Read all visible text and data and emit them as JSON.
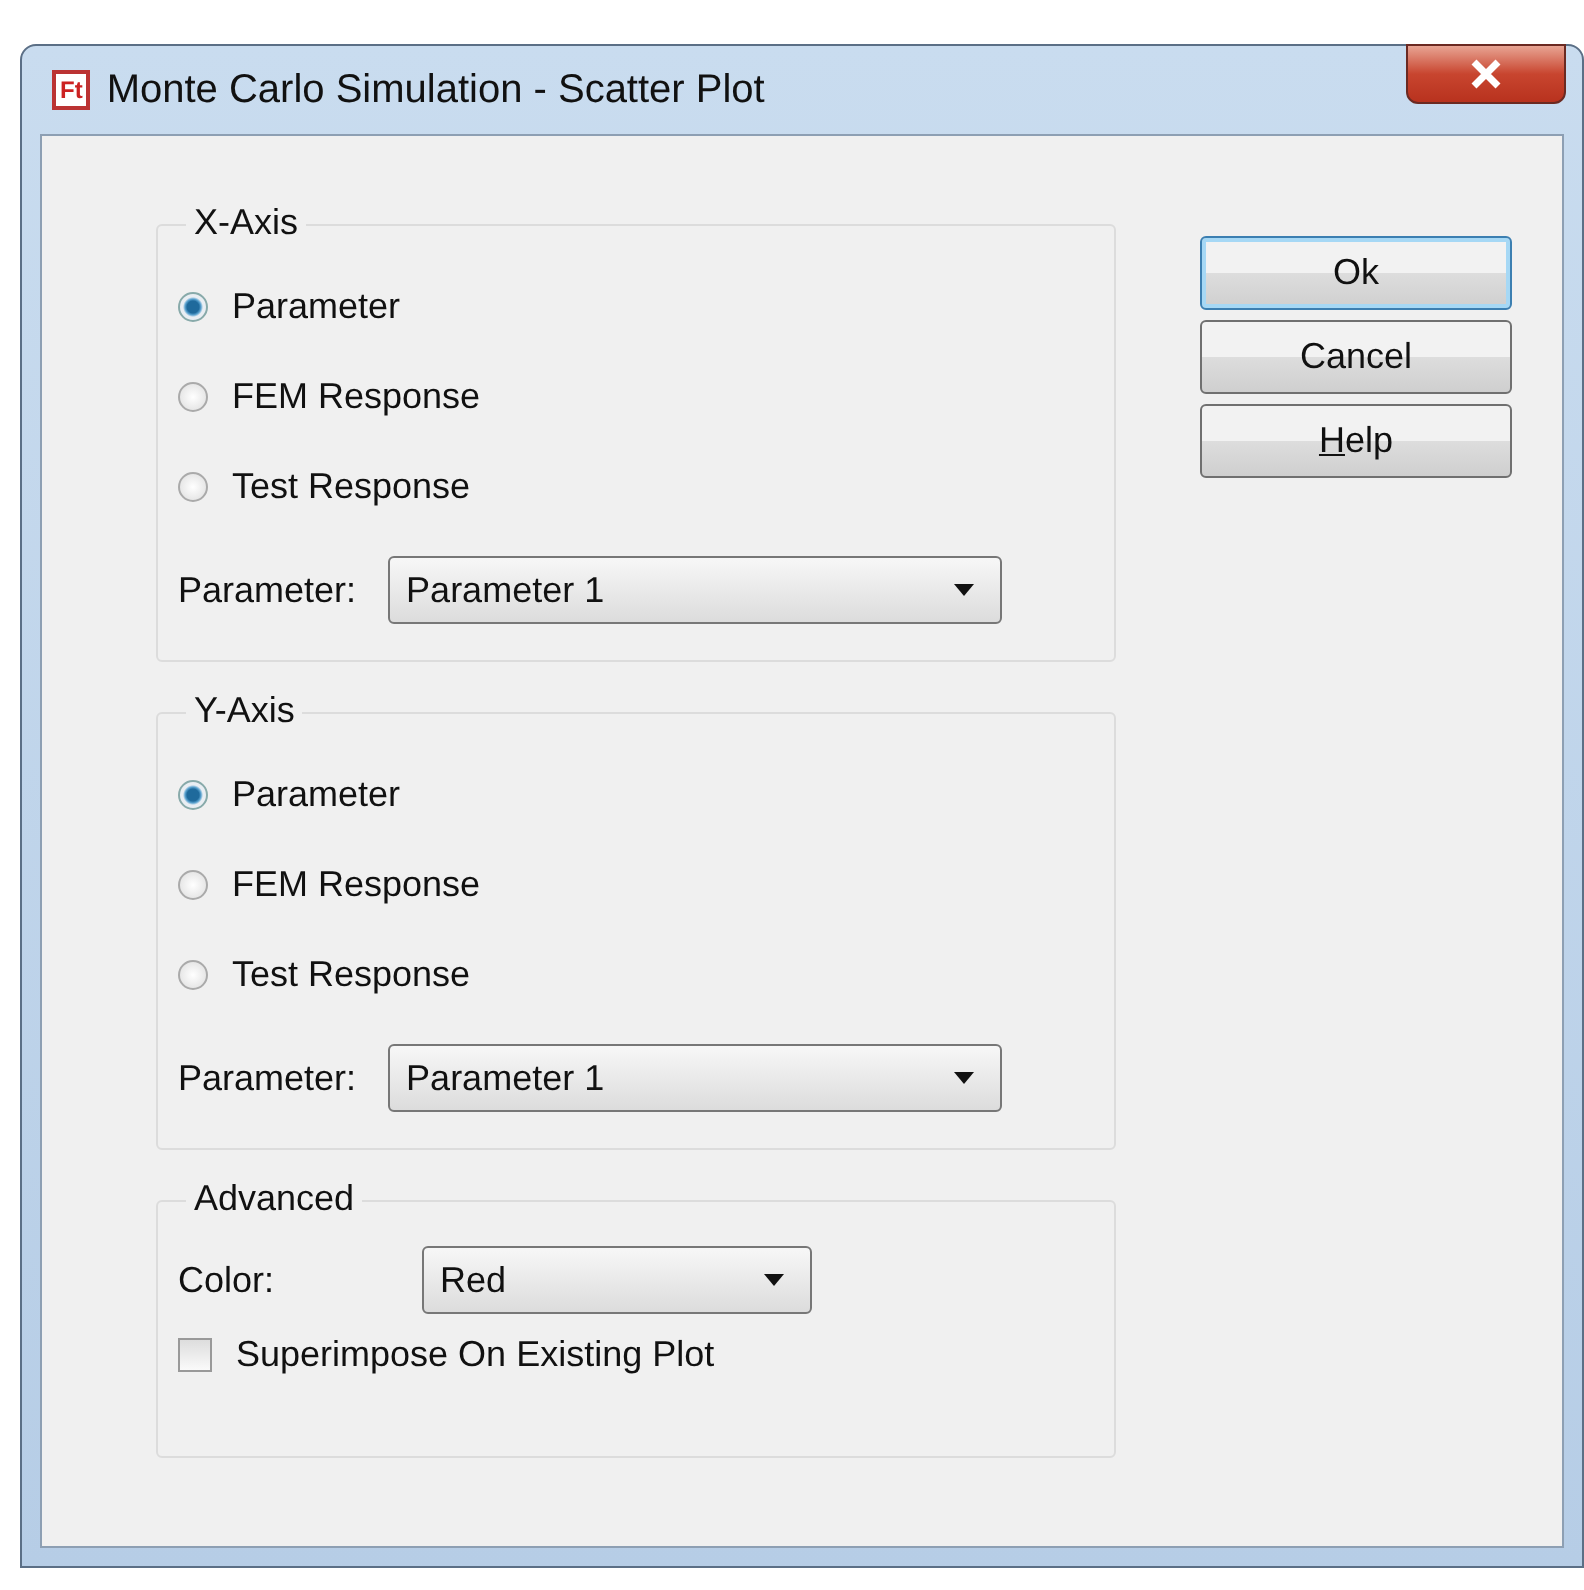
{
  "window": {
    "title": "Monte Carlo Simulation - Scatter Plot",
    "app_icon": "Ft"
  },
  "groups": [
    {
      "title": "X-Axis",
      "options": [
        {
          "label": "Parameter",
          "selected": true
        },
        {
          "label": "FEM Response",
          "selected": false
        },
        {
          "label": "Test Response",
          "selected": false
        }
      ],
      "field_label": "Parameter:",
      "value": "Parameter 1"
    },
    {
      "title": "Y-Axis",
      "options": [
        {
          "label": "Parameter",
          "selected": true
        },
        {
          "label": "FEM Response",
          "selected": false
        },
        {
          "label": "Test Response",
          "selected": false
        }
      ],
      "field_label": "Parameter:",
      "value": "Parameter 1"
    }
  ],
  "advanced": {
    "title": "Advanced",
    "color_label": "Color:",
    "color_value": "Red",
    "checkbox": {
      "label": "Superimpose On Existing Plot",
      "checked": false
    }
  },
  "buttons": [
    {
      "label": "Ok",
      "default": true,
      "underline_first": false
    },
    {
      "label": "Cancel",
      "default": false,
      "underline_first": false
    },
    {
      "label": "Help",
      "default": false,
      "underline_first": true
    }
  ]
}
